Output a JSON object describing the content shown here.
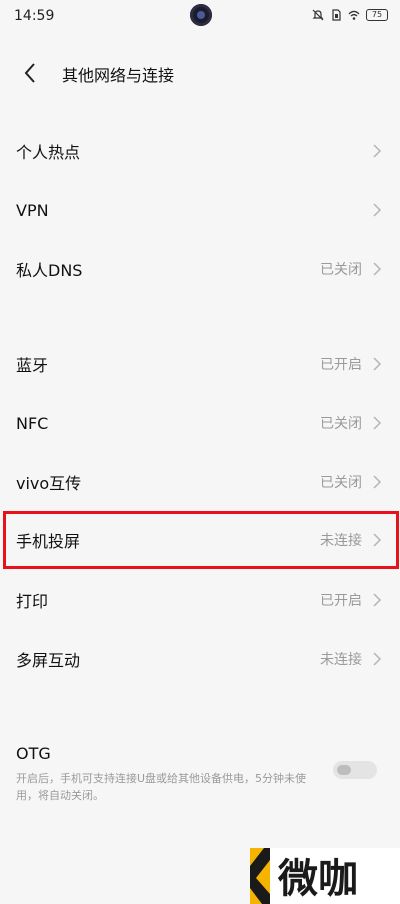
{
  "status_bar": {
    "time": "14:59",
    "battery": "75"
  },
  "header": {
    "title": "其他网络与连接"
  },
  "rows": [
    {
      "label": "个人热点",
      "value": ""
    },
    {
      "label": "VPN",
      "value": ""
    },
    {
      "label": "私人DNS",
      "value": "已关闭"
    },
    {
      "label": "蓝牙",
      "value": "已开启"
    },
    {
      "label": "NFC",
      "value": "已关闭"
    },
    {
      "label": "vivo互传",
      "value": "已关闭"
    },
    {
      "label": "手机投屏",
      "value": "未连接"
    },
    {
      "label": "打印",
      "value": "已开启"
    },
    {
      "label": "多屏互动",
      "value": "未连接"
    }
  ],
  "otg": {
    "title": "OTG",
    "description": "开启后，手机可支持连接U盘或给其他设备供电，5分钟未使用，将自动关闭。",
    "enabled": false
  },
  "watermark": {
    "text": "微咖"
  },
  "colors": {
    "highlight": "#e8121a",
    "background": "#f7f6f6",
    "secondary_text": "#9a9a9a"
  }
}
